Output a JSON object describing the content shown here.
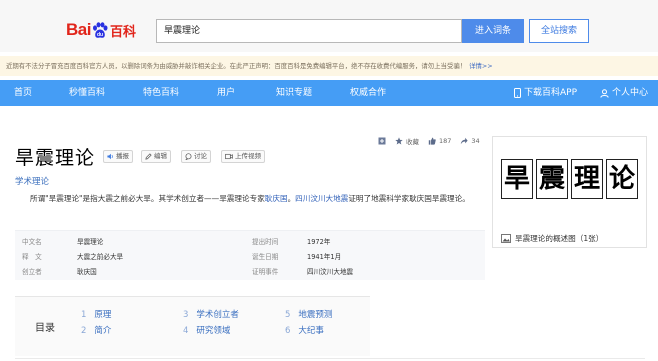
{
  "header": {
    "logo": {
      "part1": "Bai",
      "part2": "du",
      "part3": "百科"
    },
    "search_value": "旱震理论",
    "btn_enter": "进入词条",
    "btn_all": "全站搜索"
  },
  "notice": {
    "text": "近期有不法分子冒充百度百科官方人员，以删除词条为由威胁并敲诈相关企业。在此严正声明：百度百科是免费编辑平台，绝不存在收费代编服务，请勿上当受骗！",
    "more": "详情>>"
  },
  "nav": {
    "items": [
      "首页",
      "秒懂百科",
      "特色百科",
      "用户",
      "知识专题",
      "权威合作"
    ],
    "download": "下载百科APP",
    "user_center": "个人中心"
  },
  "entry": {
    "title": "旱震理论",
    "subtitle": "学术理论",
    "tools": [
      "播报",
      "编辑",
      "讨论",
      "上传视频"
    ],
    "actions": {
      "favorite": "收藏",
      "likes": "187",
      "shares": "34"
    },
    "summary_pre": "所谓\"旱震理论\"是指大震之前必大旱。其学术创立者——旱震理论专家",
    "summary_link1": "耿庆国",
    "summary_mid": "。",
    "summary_link2": "四川汶川大地震",
    "summary_post": "证明了地震科学家耿庆国旱震理论。"
  },
  "basic_info": {
    "left": [
      {
        "k": "中文名",
        "v": "旱震理论"
      },
      {
        "k": "释　文",
        "v": "大震之前必大旱"
      },
      {
        "k": "创立者",
        "v": "耿庆国"
      }
    ],
    "right": [
      {
        "k": "提出时间",
        "v": "1972年"
      },
      {
        "k": "诞生日期",
        "v": "1941年1月"
      },
      {
        "k": "证明事件",
        "v": "四川汶川大地震"
      }
    ]
  },
  "toc": {
    "label": "目录",
    "items": [
      {
        "n": "1",
        "t": "原理"
      },
      {
        "n": "2",
        "t": "简介"
      },
      {
        "n": "3",
        "t": "学术创立者"
      },
      {
        "n": "4",
        "t": "研究领域"
      },
      {
        "n": "5",
        "t": "地震预测"
      },
      {
        "n": "6",
        "t": "大纪事"
      }
    ]
  },
  "card": {
    "glyphs": [
      "旱",
      "震",
      "理",
      "论"
    ],
    "caption": "旱震理论的概述图（1张）"
  },
  "colors": {
    "nav_bg": "#459df5",
    "link": "#3060b8",
    "baidu_red": "#e1251b",
    "baidu_blue": "#2932e1"
  }
}
